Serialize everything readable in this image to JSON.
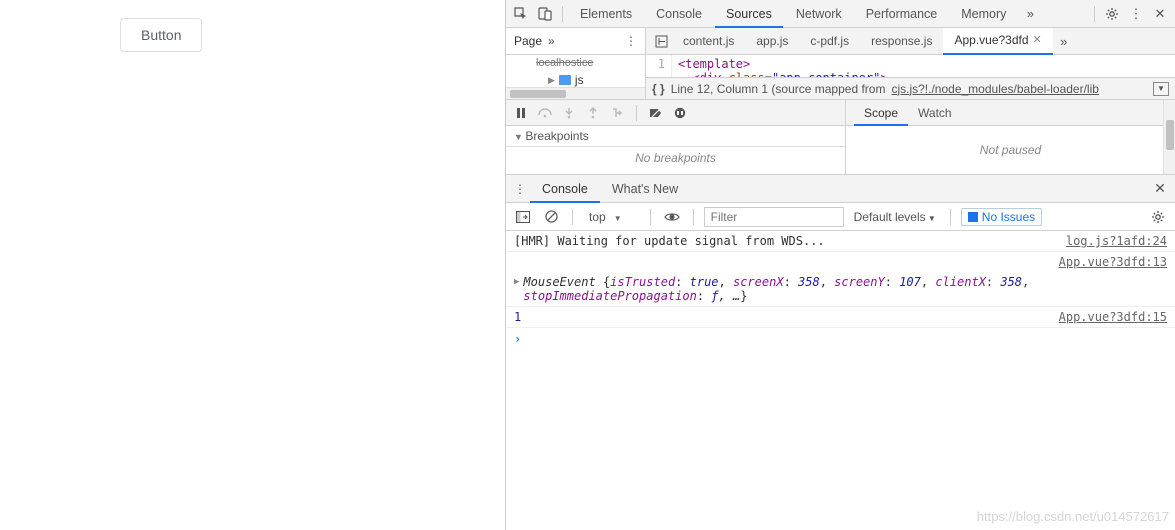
{
  "page": {
    "button_label": "Button"
  },
  "topbar": {
    "tabs": {
      "elements": "Elements",
      "console": "Console",
      "sources": "Sources",
      "network": "Network",
      "performance": "Performance",
      "memory": "Memory"
    }
  },
  "navigator": {
    "panel_label": "Page",
    "folder_item": "js",
    "cut_item": "localhostice"
  },
  "source_tabs": {
    "content": "content.js",
    "apps": "app.js",
    "cpdf": "c-pdf.js",
    "response": "response.js",
    "app_vue": "App.vue?3dfd"
  },
  "code": {
    "line1_num": "1",
    "line1_tag_open": "<",
    "line1_tag_name": "template",
    "line1_tag_close": ">",
    "line2_indent": "  ",
    "line2_open": "<",
    "line2_div": "div",
    "line2_sp": " ",
    "line2_attr": "class",
    "line2_eq": "=",
    "line2_q1": "\"",
    "line2_val": "app_container",
    "line2_q2": "\"",
    "line2_close": ">"
  },
  "status_line": {
    "text": "Line 12, Column 1  (source mapped from ",
    "link": "cjs.js?!./node_modules/babel-loader/lib"
  },
  "debugger": {
    "breakpoints_header": "Breakpoints",
    "no_breakpoints": "No breakpoints",
    "scope_tab": "Scope",
    "watch_tab": "Watch",
    "not_paused": "Not paused"
  },
  "drawer": {
    "console_tab": "Console",
    "whats_new_tab": "What's New"
  },
  "console_toolbar": {
    "context": "top",
    "filter_placeholder": "Filter",
    "levels": "Default levels",
    "issues": "No Issues"
  },
  "logs": {
    "hmr": "[HMR] Waiting for update signal from WDS...",
    "hmr_src": "log.js?1afd:24",
    "obj_src": "App.vue?3dfd:13",
    "mouse_cls": "MouseEvent ",
    "brace_open": "{",
    "k_isTrusted": "isTrusted",
    "v_true": "true",
    "k_screenX": "screenX",
    "v_358a": "358",
    "k_screenY": "screenY",
    "v_107": "107",
    "k_clientX": "clientX",
    "v_358b": "358",
    "k_stopImm": "stopImmediatePropagation",
    "v_fn": "ƒ",
    "ellipsis": ", …",
    "brace_close": "}",
    "one": "1",
    "one_src": "App.vue?3dfd:15"
  },
  "watermark": "https://blog.csdn.net/u014572617"
}
